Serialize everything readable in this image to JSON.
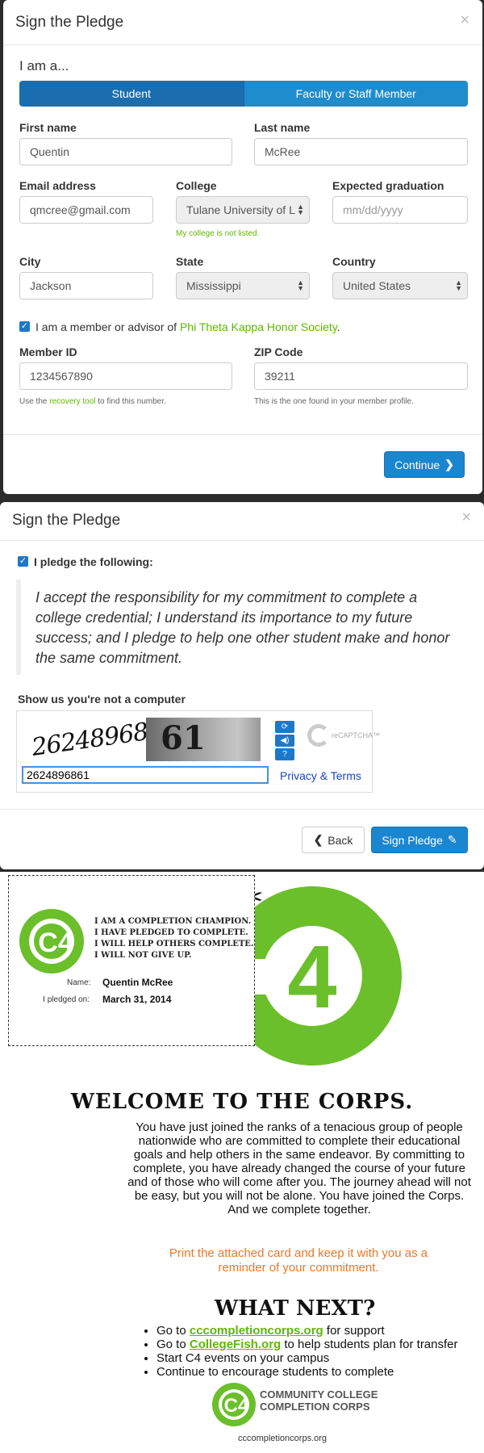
{
  "modal1": {
    "title": "Sign the Pledge",
    "close": "×",
    "iam_label": "I am a...",
    "segments": [
      "Student",
      "Faculty or Staff Member"
    ],
    "first_name": {
      "label": "First name",
      "value": "Quentin"
    },
    "last_name": {
      "label": "Last name",
      "value": "McRee"
    },
    "email": {
      "label": "Email address",
      "value": "qmcree@gmail.com"
    },
    "college": {
      "label": "College",
      "value": "Tulane University of L",
      "help": "My college is not listed."
    },
    "grad": {
      "label": "Expected graduation",
      "placeholder": "mm/dd/yyyy"
    },
    "city": {
      "label": "City",
      "value": "Jackson"
    },
    "state": {
      "label": "State",
      "value": "Mississippi"
    },
    "country": {
      "label": "Country",
      "value": "United States"
    },
    "ptk": {
      "prefix": "I am a member or advisor of ",
      "link": "Phi Theta Kappa Honor Society",
      "suffix": "."
    },
    "member_id": {
      "label": "Member ID",
      "value": "1234567890",
      "help_prefix": "Use the ",
      "help_link": "recovery tool",
      "help_suffix": " to find this number."
    },
    "zip": {
      "label": "ZIP Code",
      "value": "39211",
      "help": "This is the one found in your member profile."
    },
    "continue_label": "Continue"
  },
  "modal2": {
    "title": "Sign the Pledge",
    "close": "×",
    "pledge_check": "I pledge the following:",
    "quote": "I accept the responsibility for my commitment to complete a college credential; I understand its importance to my future success; and I pledge to help one other student make and honor the same commitment.",
    "captcha_label": "Show us you're not a computer",
    "captcha_word1": "26248968",
    "captcha_word2": "61",
    "captcha_input": "2624896861",
    "captcha_logo": "reCAPTCHA™",
    "privacy": "Privacy & Terms",
    "back_label": "Back",
    "sign_label": "Sign Pledge"
  },
  "card": {
    "logo_text": "C4",
    "lines": [
      "I AM A COMPLETION CHAMPION.",
      "I HAVE PLEDGED TO COMPLETE.",
      "I WILL HELP OTHERS COMPLETE.",
      "I WILL NOT GIVE UP."
    ],
    "name_label": "Name:",
    "name_value": "Quentin McRee",
    "date_label": "I pledged on:",
    "date_value": "March 31, 2014"
  },
  "email_body": {
    "big_logo": "4",
    "welcome": "WELCOME TO THE CORPS.",
    "paragraph": "You have just joined the ranks of a tenacious group of people nationwide who are committed to complete their educational goals and help others in the same endeavor. By committing to complete, you have already changed the course of your future and of those who will come after you. The journey ahead will not be easy, but you will not be alone. You have joined the Corps. And we complete together.",
    "print_note": "Print the attached card and keep it with you as a reminder of your commitment.",
    "what_next": "WHAT NEXT?",
    "items": [
      {
        "prefix": "Go to ",
        "link": "cccompletioncorps.org",
        "suffix": " for support"
      },
      {
        "prefix": "Go to ",
        "link": "CollegeFish.org",
        "suffix": " to help students plan for transfer"
      },
      {
        "prefix": "Start C4 events on your campus",
        "link": "",
        "suffix": ""
      },
      {
        "prefix": "Continue to encourage students to complete",
        "link": "",
        "suffix": ""
      }
    ],
    "footer_logo": "C4",
    "footer_name_1": "COMMUNITY COLLEGE",
    "footer_name_2": "COMPLETION CORPS",
    "footer_url": "cccompletioncorps.org"
  },
  "colors": {
    "primary": "#1a86cf",
    "brand_green": "#6bbf2a",
    "orange": "#e8792a"
  }
}
